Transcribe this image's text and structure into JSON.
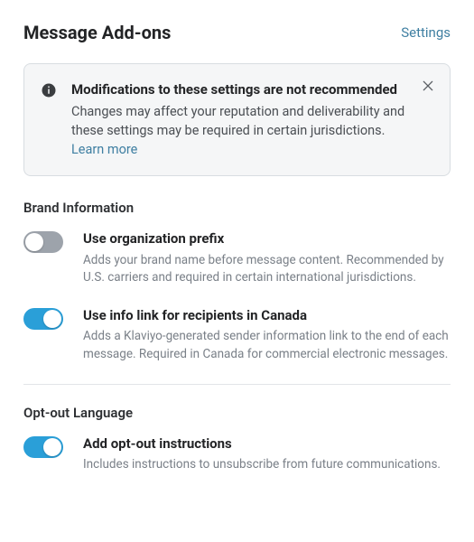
{
  "header": {
    "title": "Message Add-ons",
    "settings_link": "Settings"
  },
  "notice": {
    "title": "Modifications to these settings are not recommended",
    "body": "Changes may affect your reputation and deliverability and these settings may be required in certain jurisdictions. ",
    "learn_more": "Learn more"
  },
  "sections": {
    "brand": {
      "heading": "Brand Information",
      "items": [
        {
          "enabled": false,
          "label": "Use organization prefix",
          "description": "Adds your brand name before message content. Recommended by U.S. carriers and required in certain international jurisdictions."
        },
        {
          "enabled": true,
          "label": "Use info link for recipients in Canada",
          "description": "Adds a Klaviyo-generated sender information link to the end of each message. Required in Canada for commercial electronic messages."
        }
      ]
    },
    "optout": {
      "heading": "Opt-out Language",
      "items": [
        {
          "enabled": true,
          "label": "Add opt-out instructions",
          "description": "Includes instructions to unsubscribe from future communications."
        }
      ]
    }
  }
}
